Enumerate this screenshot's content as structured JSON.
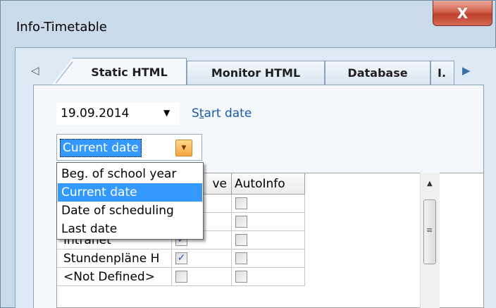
{
  "window": {
    "title": "Info-Timetable",
    "close_glyph": "X"
  },
  "tabs": {
    "scroll_left": "◁",
    "scroll_right": "▶",
    "items": [
      {
        "label": "Static HTML",
        "active": true
      },
      {
        "label": "Monitor HTML",
        "active": false
      },
      {
        "label": "Database",
        "active": false
      },
      {
        "label": "I.",
        "active": false
      }
    ]
  },
  "date_picker": {
    "value": "19.09.2014",
    "arrow": "▼",
    "link_label_prefix": "S",
    "link_label_underlined": "t",
    "link_label_rest": "art date"
  },
  "date_mode": {
    "value": "Current date",
    "options": [
      "Beg. of school year",
      "Current date",
      "Date of scheduling",
      "Last date"
    ],
    "selected_index": 1,
    "button_glyph": "▼"
  },
  "table": {
    "headers": [
      "",
      "ve",
      "AutoInfo"
    ],
    "rows": [
      {
        "name": "",
        "active": false,
        "autoinfo": false
      },
      {
        "name": "",
        "active": false,
        "autoinfo": false
      },
      {
        "name": "Intranet",
        "active": true,
        "autoinfo": false
      },
      {
        "name": "Stundenpläne H",
        "active": true,
        "autoinfo": false
      },
      {
        "name": "<Not Defined>",
        "active": false,
        "autoinfo": false
      }
    ],
    "check_glyph": "✓"
  },
  "scrollbar": {
    "up_glyph": "▲",
    "grip_glyph": "≡"
  },
  "colors": {
    "accent": "#3399ff",
    "link": "#1c5aa6",
    "close": "#c0412c"
  }
}
